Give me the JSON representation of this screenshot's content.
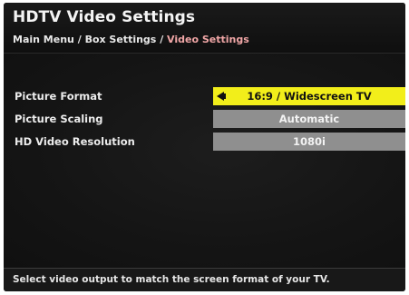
{
  "header": {
    "title": "HDTV Video Settings",
    "breadcrumb": {
      "main_menu": "Main Menu",
      "separator": " / ",
      "box_settings": "Box Settings",
      "current": "Video Settings"
    }
  },
  "settings": [
    {
      "label": "Picture Format",
      "value": "16:9 / Widescreen TV",
      "selected": true
    },
    {
      "label": "Picture Scaling",
      "value": "Automatic",
      "selected": false
    },
    {
      "label": "HD Video Resolution",
      "value": "1080i",
      "selected": false
    }
  ],
  "icons": {
    "selector_arrow": "left-arrow-icon"
  },
  "footer": {
    "help_text": "Select video output to match the screen format of your TV."
  },
  "colors": {
    "selected_bg": "#f2ee1a",
    "option_bg": "#8f8f8f",
    "breadcrumb_current": "#f0a6a6",
    "screen_bg": "#131313"
  }
}
